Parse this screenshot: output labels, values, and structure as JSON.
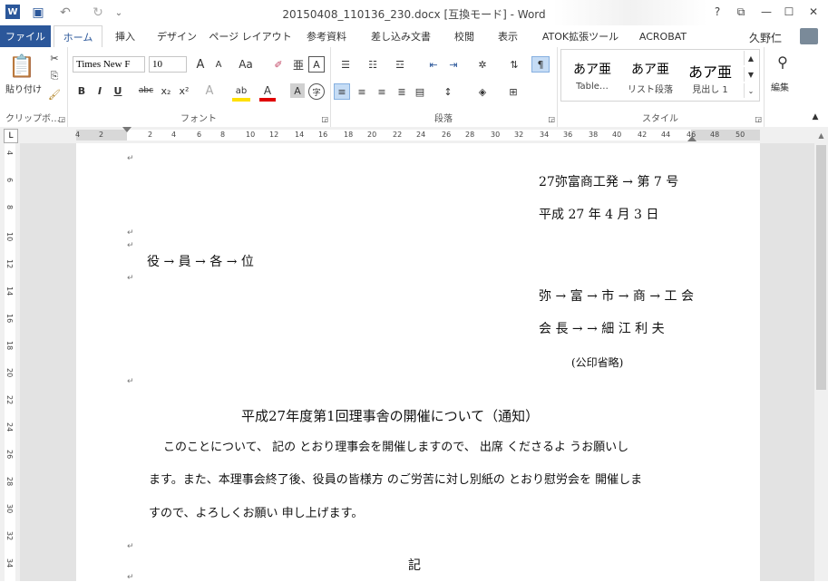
{
  "window": {
    "title": "20150408_110136_230.docx [互換モード] - Word",
    "help": "?",
    "user": "久野仁"
  },
  "tabs": [
    "ファイル",
    "ホーム",
    "挿入",
    "デザイン",
    "ページ レイアウト",
    "参考資料",
    "差し込み文書",
    "校閲",
    "表示",
    "ATOK拡張ツール",
    "ACROBAT"
  ],
  "ribbon": {
    "clipboard": {
      "label": "クリップボ…",
      "paste": "貼り付け"
    },
    "font": {
      "label": "フォント",
      "name": "Times New F",
      "size": "10"
    },
    "paragraph": {
      "label": "段落"
    },
    "styles": {
      "label": "スタイル",
      "items": [
        {
          "sample": "あア亜",
          "name": "Table…"
        },
        {
          "sample": "あア亜",
          "name": "リスト段落"
        },
        {
          "sample": "あア亜",
          "name": "見出し 1"
        }
      ]
    },
    "editing": {
      "label": "編集"
    }
  },
  "ruler": {
    "h_ticks": [
      "4",
      "2",
      "2",
      "4",
      "6",
      "8",
      "10",
      "12",
      "14",
      "16",
      "18",
      "20",
      "22",
      "24",
      "26",
      "28",
      "30",
      "32",
      "34",
      "36",
      "38",
      "40",
      "42",
      "44",
      "46",
      "48",
      "50"
    ],
    "v_ticks": [
      "4",
      "6",
      "8",
      "10",
      "12",
      "14",
      "16",
      "18",
      "20",
      "22",
      "24",
      "26",
      "28",
      "30",
      "32",
      "34"
    ]
  },
  "document": {
    "doc_number": "27弥富商工発 →  第 7 号",
    "date": "平成 27 年 4 月 3 日",
    "recipient": "役 → 員 → 各 → 位",
    "sender_org": "弥 → 富 → 市 → 商 → 工  会",
    "sender_name": "会 長 →  → 細  江  利  夫",
    "seal": "(公印省略)",
    "subject": "平成27年度第1回理事舎の開催について（通知）",
    "body_line1": "このことについて、  記の とおり理事会を開催しますので、  出席 くださるよ うお願いし",
    "body_line2": "ます。また、本理事会終了後、役員の皆様方 のご労苦に対し別紙の とおり慰労会を 開催しま",
    "body_line3": "すので、よろしくお願い 申し上げます。",
    "ki": "記"
  }
}
